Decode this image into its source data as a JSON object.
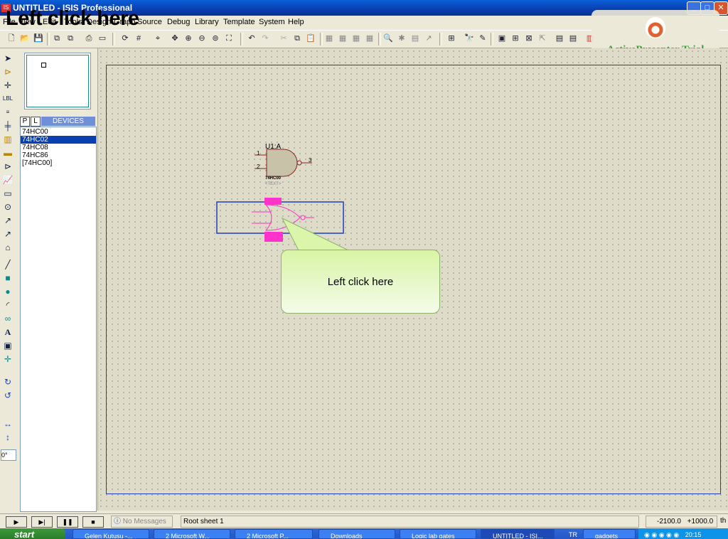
{
  "window": {
    "title": "UNTITLED - ISIS Professional",
    "minimize": "_",
    "maximize": "□",
    "close": "✕"
  },
  "overlay_title": "Left click here",
  "menu": [
    "File",
    "View",
    "Edit",
    "Tools",
    "Design",
    "Graph",
    "Source",
    "Debug",
    "Library",
    "Template",
    "System",
    "Help"
  ],
  "trial": {
    "text": "ActivePresenter Trial"
  },
  "device_panel": {
    "p_label": "P",
    "l_label": "L",
    "header": "DEVICES",
    "devices": [
      "74HC00",
      "74HC02",
      "74HC08",
      "74HC86",
      "[74HC00]"
    ],
    "selected_index": 1
  },
  "tool_angle": "0°",
  "schematic": {
    "component1": {
      "ref": "U1:A",
      "part": "74HC00",
      "text": "<TEXT>",
      "pins": [
        "1",
        "2",
        "3"
      ]
    }
  },
  "callout": {
    "text": "Left click here"
  },
  "status": {
    "messages": "No Messages",
    "sheet": "Root sheet 1",
    "x": "-2100.0",
    "y": "+1000.0",
    "units": "th"
  },
  "taskbar": {
    "start": "start",
    "tasks": [
      "Gelen Kutusu -...",
      "2 Microsoft W...",
      "2 Microsoft P...",
      "Downloads",
      "Logic lab gates",
      "UNTITLED - ISI...",
      "gadgets"
    ],
    "tray": {
      "lang": "TR",
      "time": "20:15"
    }
  },
  "colors": {
    "selection_box": "#1f3fbf",
    "highlight_magenta": "#ff33cc",
    "gate_fill": "#c8c3a8",
    "gate_stroke": "#8a2020"
  }
}
